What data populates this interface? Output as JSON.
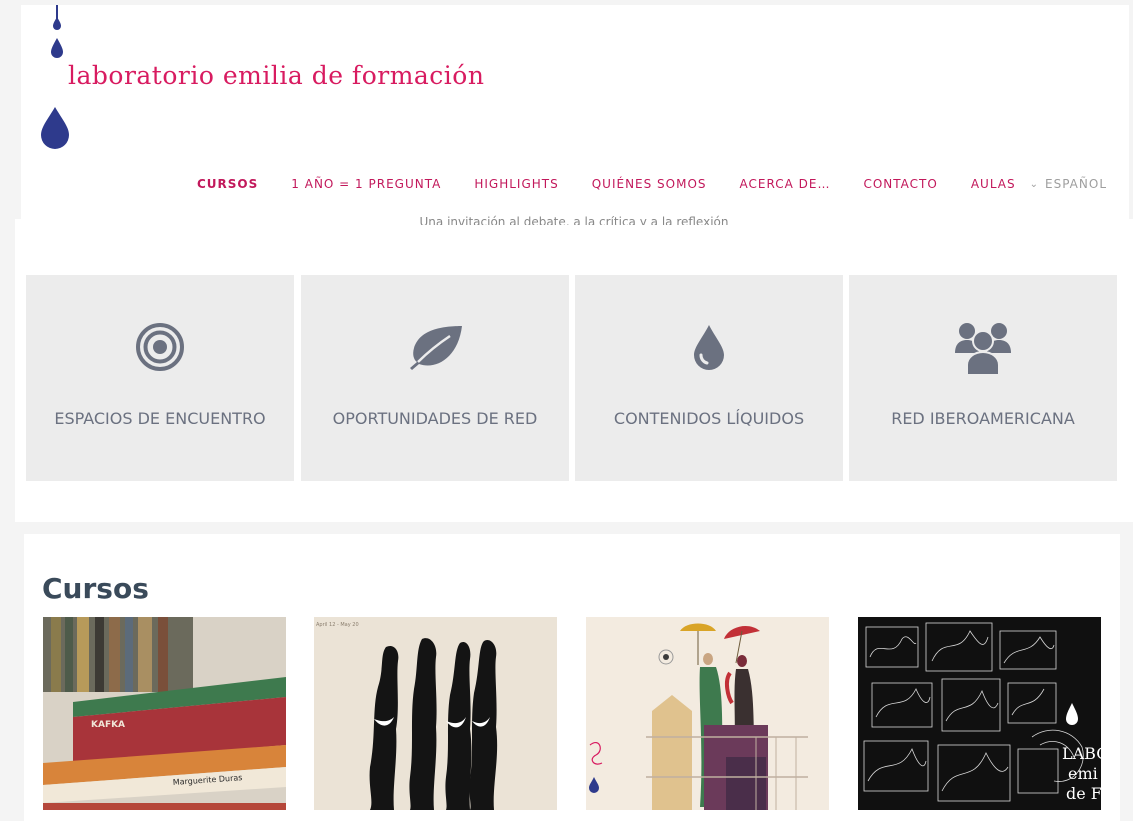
{
  "site": {
    "brand_line1": "laboratorio emilia de formación",
    "colors": {
      "brand": "#d81b60",
      "drop": "#2e3a8c",
      "icon": "#6b7180"
    }
  },
  "nav": {
    "items": [
      {
        "label": "CURSOS",
        "active": true
      },
      {
        "label": "1 AÑO = 1 PREGUNTA"
      },
      {
        "label": "HIGHLIGHTS"
      },
      {
        "label": "QUIÉNES SOMOS"
      },
      {
        "label": "ACERCA DE…"
      },
      {
        "label": "CONTACTO"
      },
      {
        "label": "AULAS"
      }
    ],
    "language": "ESPAÑOL"
  },
  "hero": {
    "tagline": "Una invitación al debate, a la crítica y a la reflexión"
  },
  "features": [
    {
      "label": "ESPACIOS DE ENCUENTRO",
      "icon": "target-icon"
    },
    {
      "label": "OPORTUNIDADES DE RED",
      "icon": "leaf-icon"
    },
    {
      "label": "CONTENIDOS LÍQUIDOS",
      "icon": "drop-icon"
    },
    {
      "label": "RED IBEROAMERICANA",
      "icon": "users-icon"
    }
  ],
  "courses": {
    "title": "Cursos",
    "items": [
      {
        "image": "books-stack-image",
        "book_labels": [
          "KAFKA",
          "Marguerite Duras"
        ]
      },
      {
        "image": "ink-figures-image",
        "caption": "April 12 - May 20"
      },
      {
        "image": "umbrella-women-illustration"
      },
      {
        "image": "sketches-dark-image",
        "overlay_text": [
          "LABO",
          "emi",
          "de F"
        ]
      }
    ]
  }
}
